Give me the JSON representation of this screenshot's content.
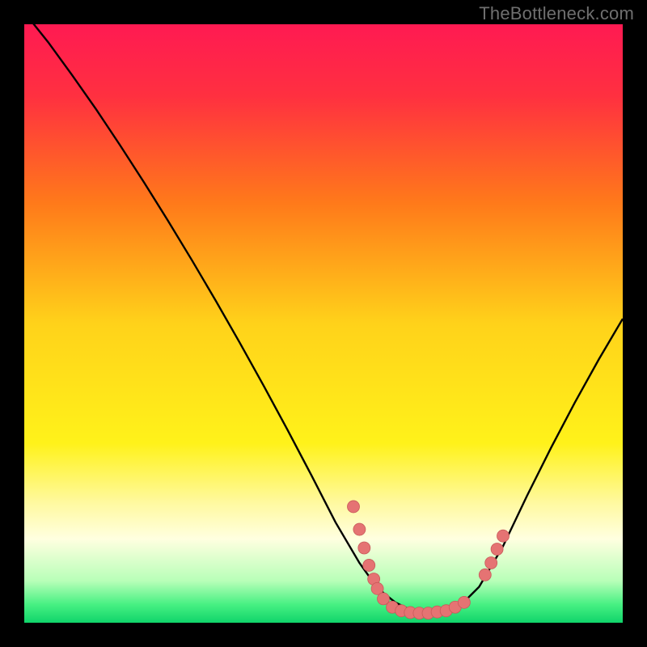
{
  "watermark": "TheBottleneck.com",
  "colors": {
    "background": "#000000",
    "gradient_stops": [
      {
        "offset": 0.0,
        "color": "#ff1a52"
      },
      {
        "offset": 0.12,
        "color": "#ff3040"
      },
      {
        "offset": 0.3,
        "color": "#ff7a1a"
      },
      {
        "offset": 0.5,
        "color": "#ffd21a"
      },
      {
        "offset": 0.7,
        "color": "#fff21a"
      },
      {
        "offset": 0.8,
        "color": "#fff9a0"
      },
      {
        "offset": 0.86,
        "color": "#ffffe0"
      },
      {
        "offset": 0.93,
        "color": "#b8ffb8"
      },
      {
        "offset": 0.97,
        "color": "#46f082"
      },
      {
        "offset": 1.0,
        "color": "#10d46a"
      }
    ],
    "curve": "#000000",
    "dot_fill": "#e57373",
    "dot_stroke": "#c85a5a",
    "text": "#6f6f6f"
  },
  "chart_data": {
    "type": "line",
    "title": "",
    "xlabel": "",
    "ylabel": "",
    "xlim": [
      0,
      100
    ],
    "ylim": [
      0,
      100
    ],
    "x": [
      0,
      4,
      8,
      12,
      16,
      20,
      24,
      28,
      32,
      36,
      40,
      44,
      48,
      52,
      56,
      58,
      60,
      62,
      64,
      66,
      68,
      70,
      72,
      74,
      76,
      80,
      84,
      88,
      92,
      96,
      100
    ],
    "values": [
      102,
      97,
      91.5,
      85.8,
      79.8,
      73.6,
      67.2,
      60.6,
      53.8,
      46.8,
      39.6,
      32.2,
      24.6,
      16.8,
      10.0,
      7.2,
      5.0,
      3.4,
      2.4,
      2.0,
      2.0,
      2.2,
      2.8,
      4.0,
      6.0,
      12.8,
      21.2,
      29.2,
      36.8,
      44.0,
      50.8
    ],
    "dots": [
      {
        "x": 55.0,
        "y": 19.4
      },
      {
        "x": 56.0,
        "y": 15.6
      },
      {
        "x": 56.8,
        "y": 12.5
      },
      {
        "x": 57.6,
        "y": 9.6
      },
      {
        "x": 58.4,
        "y": 7.3
      },
      {
        "x": 59.0,
        "y": 5.7
      },
      {
        "x": 60.0,
        "y": 4.0
      },
      {
        "x": 61.5,
        "y": 2.6
      },
      {
        "x": 63.0,
        "y": 2.0
      },
      {
        "x": 64.5,
        "y": 1.7
      },
      {
        "x": 66.0,
        "y": 1.6
      },
      {
        "x": 67.5,
        "y": 1.6
      },
      {
        "x": 69.0,
        "y": 1.8
      },
      {
        "x": 70.5,
        "y": 2.0
      },
      {
        "x": 72.0,
        "y": 2.6
      },
      {
        "x": 73.5,
        "y": 3.4
      },
      {
        "x": 77.0,
        "y": 8.0
      },
      {
        "x": 78.0,
        "y": 10.0
      },
      {
        "x": 79.0,
        "y": 12.3
      },
      {
        "x": 80.0,
        "y": 14.5
      }
    ],
    "note": "x/y are 0..100 percent of plot area; y measured from bottom; values qualitative (no visible axes)"
  }
}
